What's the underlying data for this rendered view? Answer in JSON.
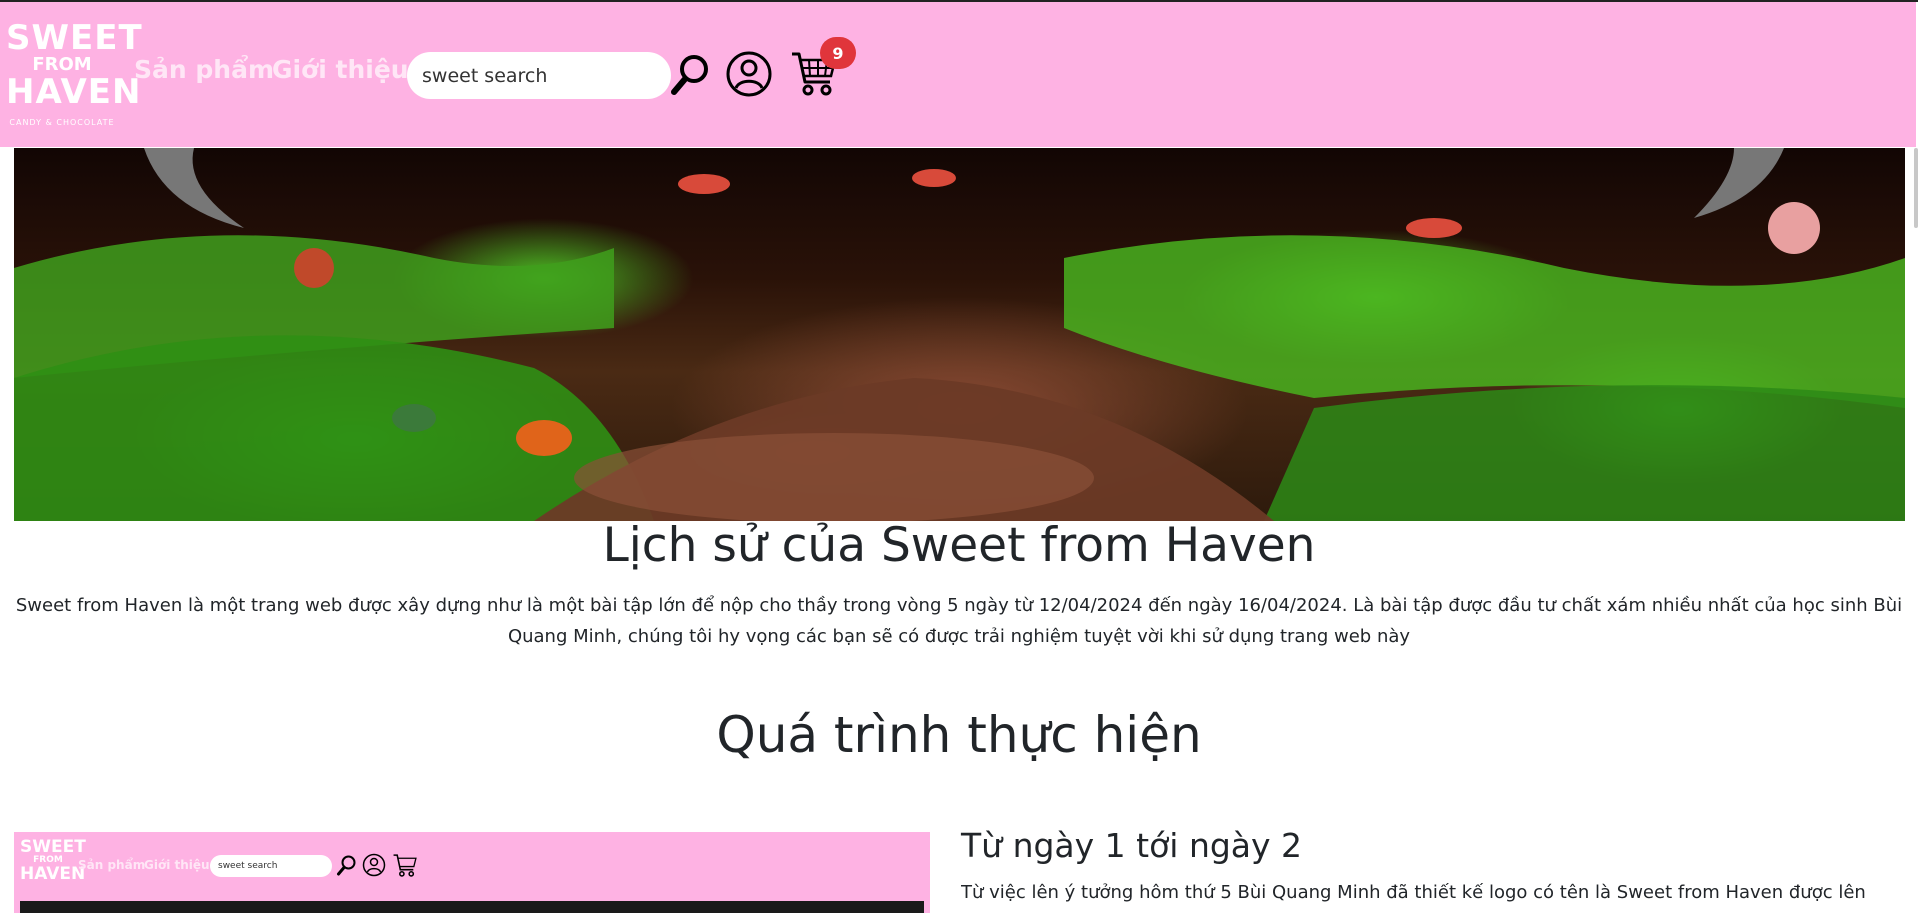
{
  "logo": {
    "line1": "SWEET",
    "line2": "FROM",
    "line3": "HAVEN",
    "tagline": "CANDY & CHOCOLATE"
  },
  "nav": {
    "products": "Sản phẩm",
    "about": "Giới thiệu"
  },
  "search": {
    "value": "sweet search",
    "placeholder": "sweet search"
  },
  "cart": {
    "count": "9"
  },
  "colors": {
    "navbar": "#feb2e3",
    "badge": "#e0353b",
    "nav_link": "#ffe6f6"
  },
  "icons": {
    "search": "magnifier-icon",
    "account": "user-circle-icon",
    "cart": "shopping-cart-icon"
  },
  "hero": {
    "title": "Lịch sử của Sweet from Haven",
    "description": "Sweet from Haven là một trang web được xây dựng như là một bài tập lớn để nộp cho thầy trong vòng 5 ngày từ 12/04/2024 đến ngày 16/04/2024. Là bài tập được đầu tư chất xám nhiều nhất của học sinh Bùi Quang Minh, chúng tôi hy vọng các bạn sẽ có được trải nghiệm tuyệt vời khi sử dụng trang web này"
  },
  "process": {
    "title": "Quá trình thực hiện",
    "steps": [
      {
        "title": "Từ ngày 1 tới ngày 2",
        "text": "Từ việc lên ý tưởng hôm thứ 5 Bùi Quang Minh đã thiết kế logo có tên là Sweet from Haven được lên"
      }
    ]
  },
  "thumbnail": {
    "logo_line1": "SWEET",
    "logo_line2": "FROM",
    "logo_line3": "HAVEN",
    "products": "Sản phẩm",
    "about": "Giới thiệu",
    "search": "sweet search"
  }
}
